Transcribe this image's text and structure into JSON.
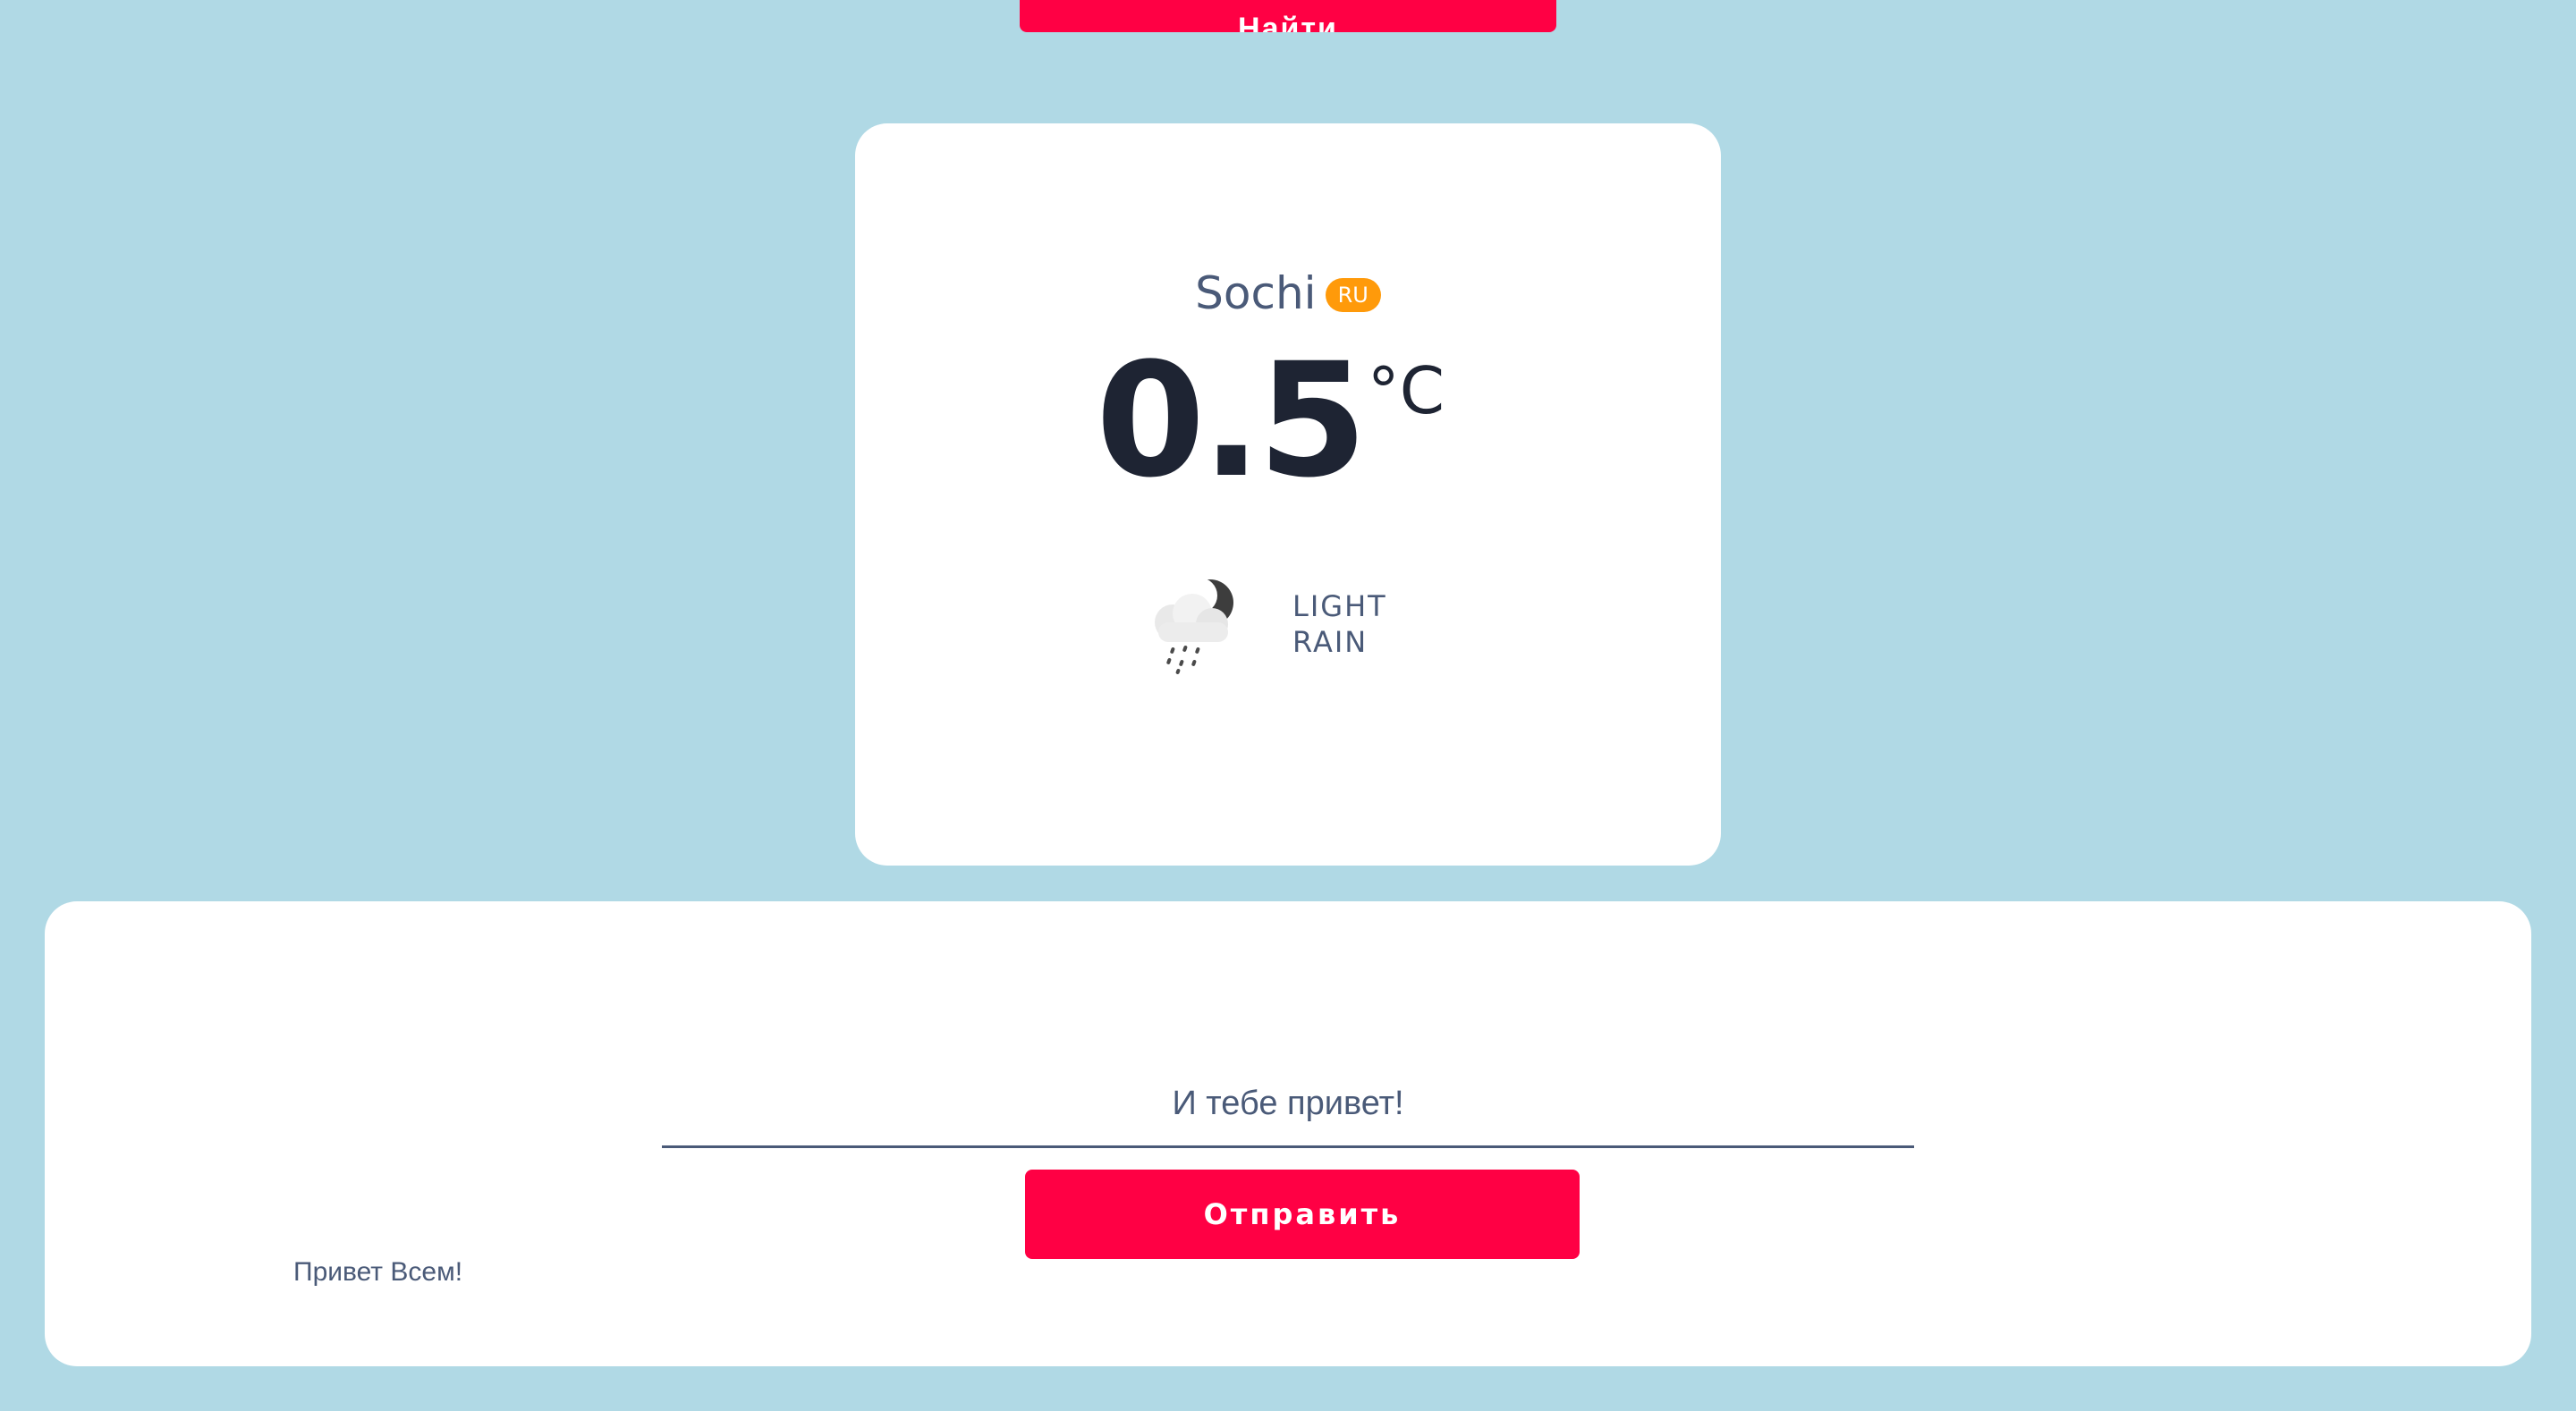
{
  "top_button": {
    "label": "Найти"
  },
  "weather": {
    "city": "Sochi",
    "country": "RU",
    "temperature": "0.5",
    "unit": "°C",
    "condition_line1": "LIGHT",
    "condition_line2": "RAIN",
    "icon": "light-rain-night-icon"
  },
  "chat": {
    "input_value": "И тебе привет!",
    "send_label": "Отправить",
    "messages": [
      "Привет Всем!"
    ]
  },
  "colors": {
    "background": "#b0d9e5",
    "accent": "#ff0044",
    "badge": "#ff9a0a",
    "text": "#4a5a78",
    "dark_text": "#1e2433"
  }
}
